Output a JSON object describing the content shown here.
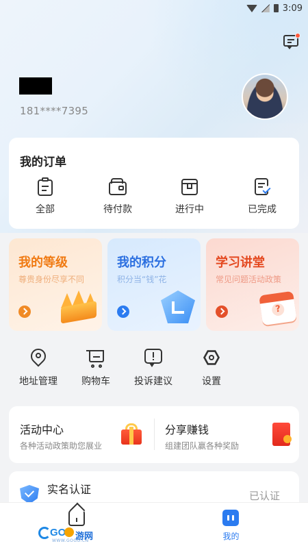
{
  "status_bar": {
    "time": "3:09"
  },
  "header": {
    "phone": "181****7395"
  },
  "orders": {
    "title": "我的订单",
    "items": [
      {
        "label": "全部",
        "icon": "clipboard-icon"
      },
      {
        "label": "待付款",
        "icon": "wallet-icon"
      },
      {
        "label": "进行中",
        "icon": "package-icon"
      },
      {
        "label": "已完成",
        "icon": "checklist-icon"
      }
    ]
  },
  "promos": [
    {
      "title": "我的等级",
      "subtitle": "尊贵身份尽享不同",
      "icon": "crown-icon",
      "color": "#f07a12"
    },
    {
      "title": "我的积分",
      "subtitle": "积分当“钱”花",
      "icon": "points-shield-icon",
      "color": "#2b6fe0"
    },
    {
      "title": "学习讲堂",
      "subtitle": "常见问题活动政策",
      "icon": "calendar-question-icon",
      "color": "#e4481f"
    }
  ],
  "tools": [
    {
      "label": "地址管理",
      "icon": "location-pin-icon"
    },
    {
      "label": "购物车",
      "icon": "cart-icon"
    },
    {
      "label": "投诉建议",
      "icon": "feedback-icon"
    },
    {
      "label": "设置",
      "icon": "gear-icon"
    }
  ],
  "activity": {
    "center": {
      "title": "活动中心",
      "subtitle": "各种活动政策助您展业",
      "icon": "gift-icon"
    },
    "share": {
      "title": "分享赚钱",
      "subtitle": "组建团队赢各种奖励",
      "icon": "red-envelope-icon"
    }
  },
  "verify": {
    "title": "实名认证",
    "status": "已认证",
    "icon": "verified-shield-icon"
  },
  "tabbar": {
    "tabs": [
      {
        "label": "首页",
        "icon": "home-icon",
        "active": false
      },
      {
        "label": "我的",
        "icon": "profile-icon",
        "active": true
      }
    ]
  },
  "watermark": {
    "brand": "GO",
    "text": "游网",
    "sub": "WWW.GOGO.CN"
  },
  "colors": {
    "accent": "#2b7bf0",
    "background": "#f2f3f5"
  }
}
